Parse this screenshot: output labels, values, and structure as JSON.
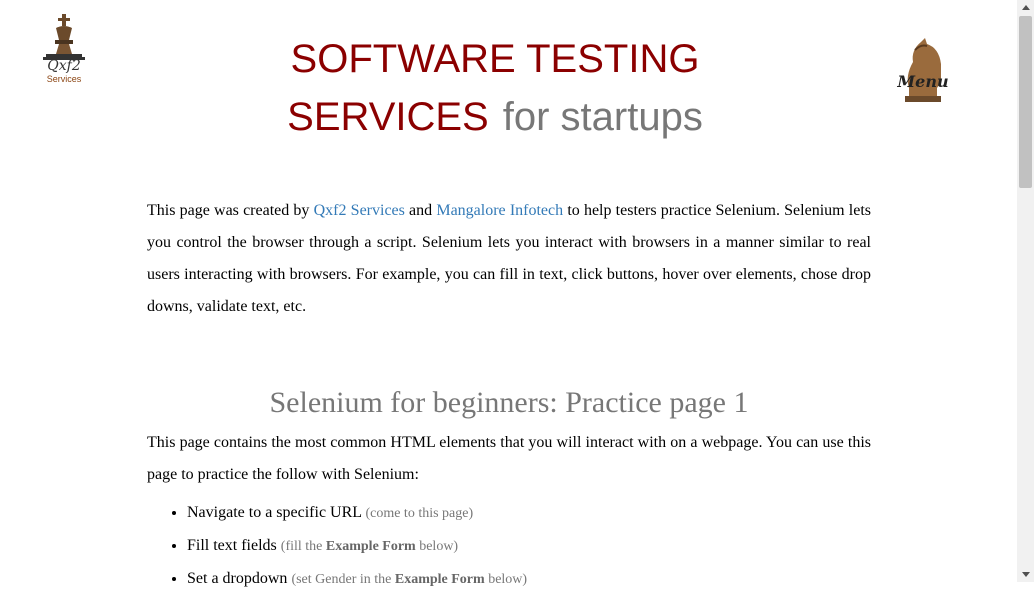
{
  "header": {
    "title_red_line1": "SOFTWARE TESTING",
    "title_red_line2": "SERVICES",
    "title_gray": "for startups",
    "logo_text": "Qxf2",
    "logo_sub": "Services",
    "menu_label": "Menu"
  },
  "intro": {
    "part1": "This page was created by ",
    "link1": "Qxf2 Services",
    "part2": " and ",
    "link2": "Mangalore Infotech",
    "part3": " to help testers practice Selenium. Selenium lets you control the browser through a script. Selenium lets you interact with browsers in a manner similar to real users interacting with browsers. For example, you can fill in text, click buttons, hover over elements, chose drop downs, validate text, etc."
  },
  "section": {
    "title": "Selenium for beginners: Practice page 1",
    "description": "This page contains the most common HTML elements that you will interact with on a webpage. You can use this page to practice the follow with Selenium:"
  },
  "list": [
    {
      "text": "Navigate to a specific URL ",
      "note_pre": "(come to this page)",
      "note_bold": "",
      "note_post": ""
    },
    {
      "text": "Fill text fields ",
      "note_pre": "(fill the ",
      "note_bold": "Example Form",
      "note_post": " below)"
    },
    {
      "text": "Set a dropdown ",
      "note_pre": "(set Gender in the ",
      "note_bold": "Example Form",
      "note_post": " below)"
    }
  ],
  "colors": {
    "title_red": "#8b0000",
    "title_gray": "#777777",
    "link": "#337ab7"
  }
}
